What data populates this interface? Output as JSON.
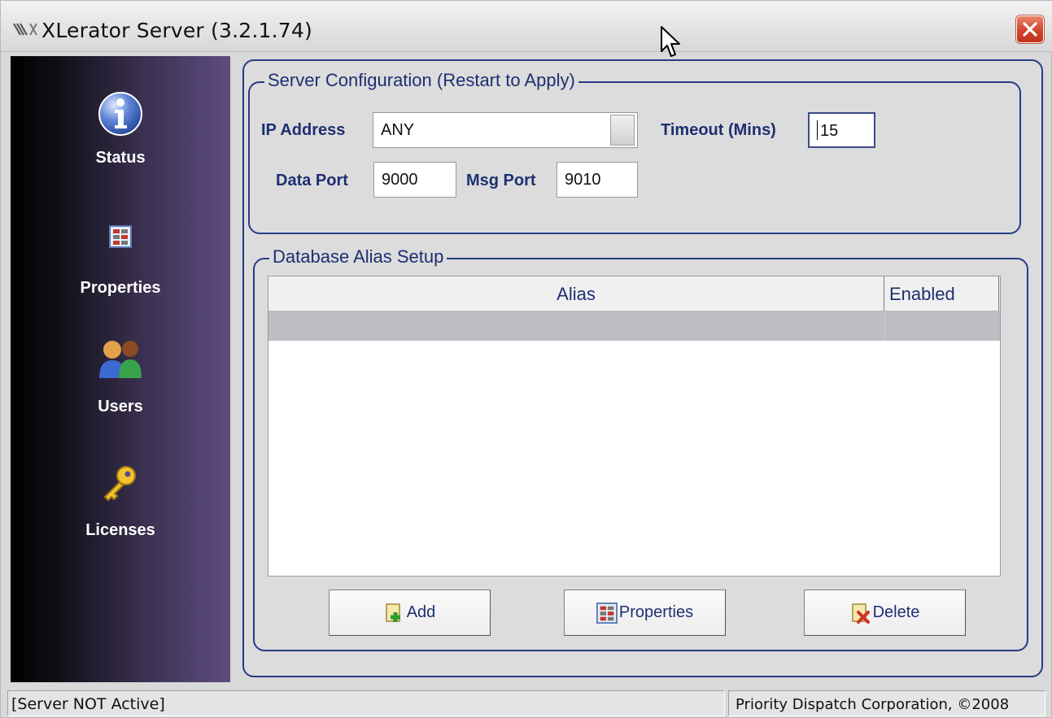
{
  "window": {
    "title": "XLerator Server (3.2.1.74)",
    "icons": {
      "app": "xlerator-app-icon",
      "close": "close-icon",
      "cursor": "mouse-pointer-icon"
    }
  },
  "sidebar": {
    "items": [
      {
        "label": "Status",
        "icon": "info-icon"
      },
      {
        "label": "Properties",
        "icon": "properties-icon"
      },
      {
        "label": "Users",
        "icon": "users-icon"
      },
      {
        "label": "Licenses",
        "icon": "key-icon"
      }
    ]
  },
  "server_config": {
    "legend": "Server Configuration (Restart to Apply)",
    "ip_label": "IP Address",
    "ip_value": "ANY",
    "timeout_label": "Timeout (Mins)",
    "timeout_value": "15",
    "data_port_label": "Data Port",
    "data_port_value": "9000",
    "msg_port_label": "Msg Port",
    "msg_port_value": "9010"
  },
  "alias_setup": {
    "legend": "Database Alias Setup",
    "columns": [
      "Alias",
      "Enabled"
    ],
    "rows": []
  },
  "buttons": {
    "add": "Add",
    "properties": "Properties",
    "delete": "Delete"
  },
  "statusbar": {
    "left": "[Server NOT Active]",
    "right": "Priority Dispatch Corporation, ©2008"
  },
  "colors": {
    "accent": "#263b87",
    "label_text": "#1d2f72",
    "sidebar_dark": "#000000",
    "sidebar_light": "#5e4c80"
  }
}
